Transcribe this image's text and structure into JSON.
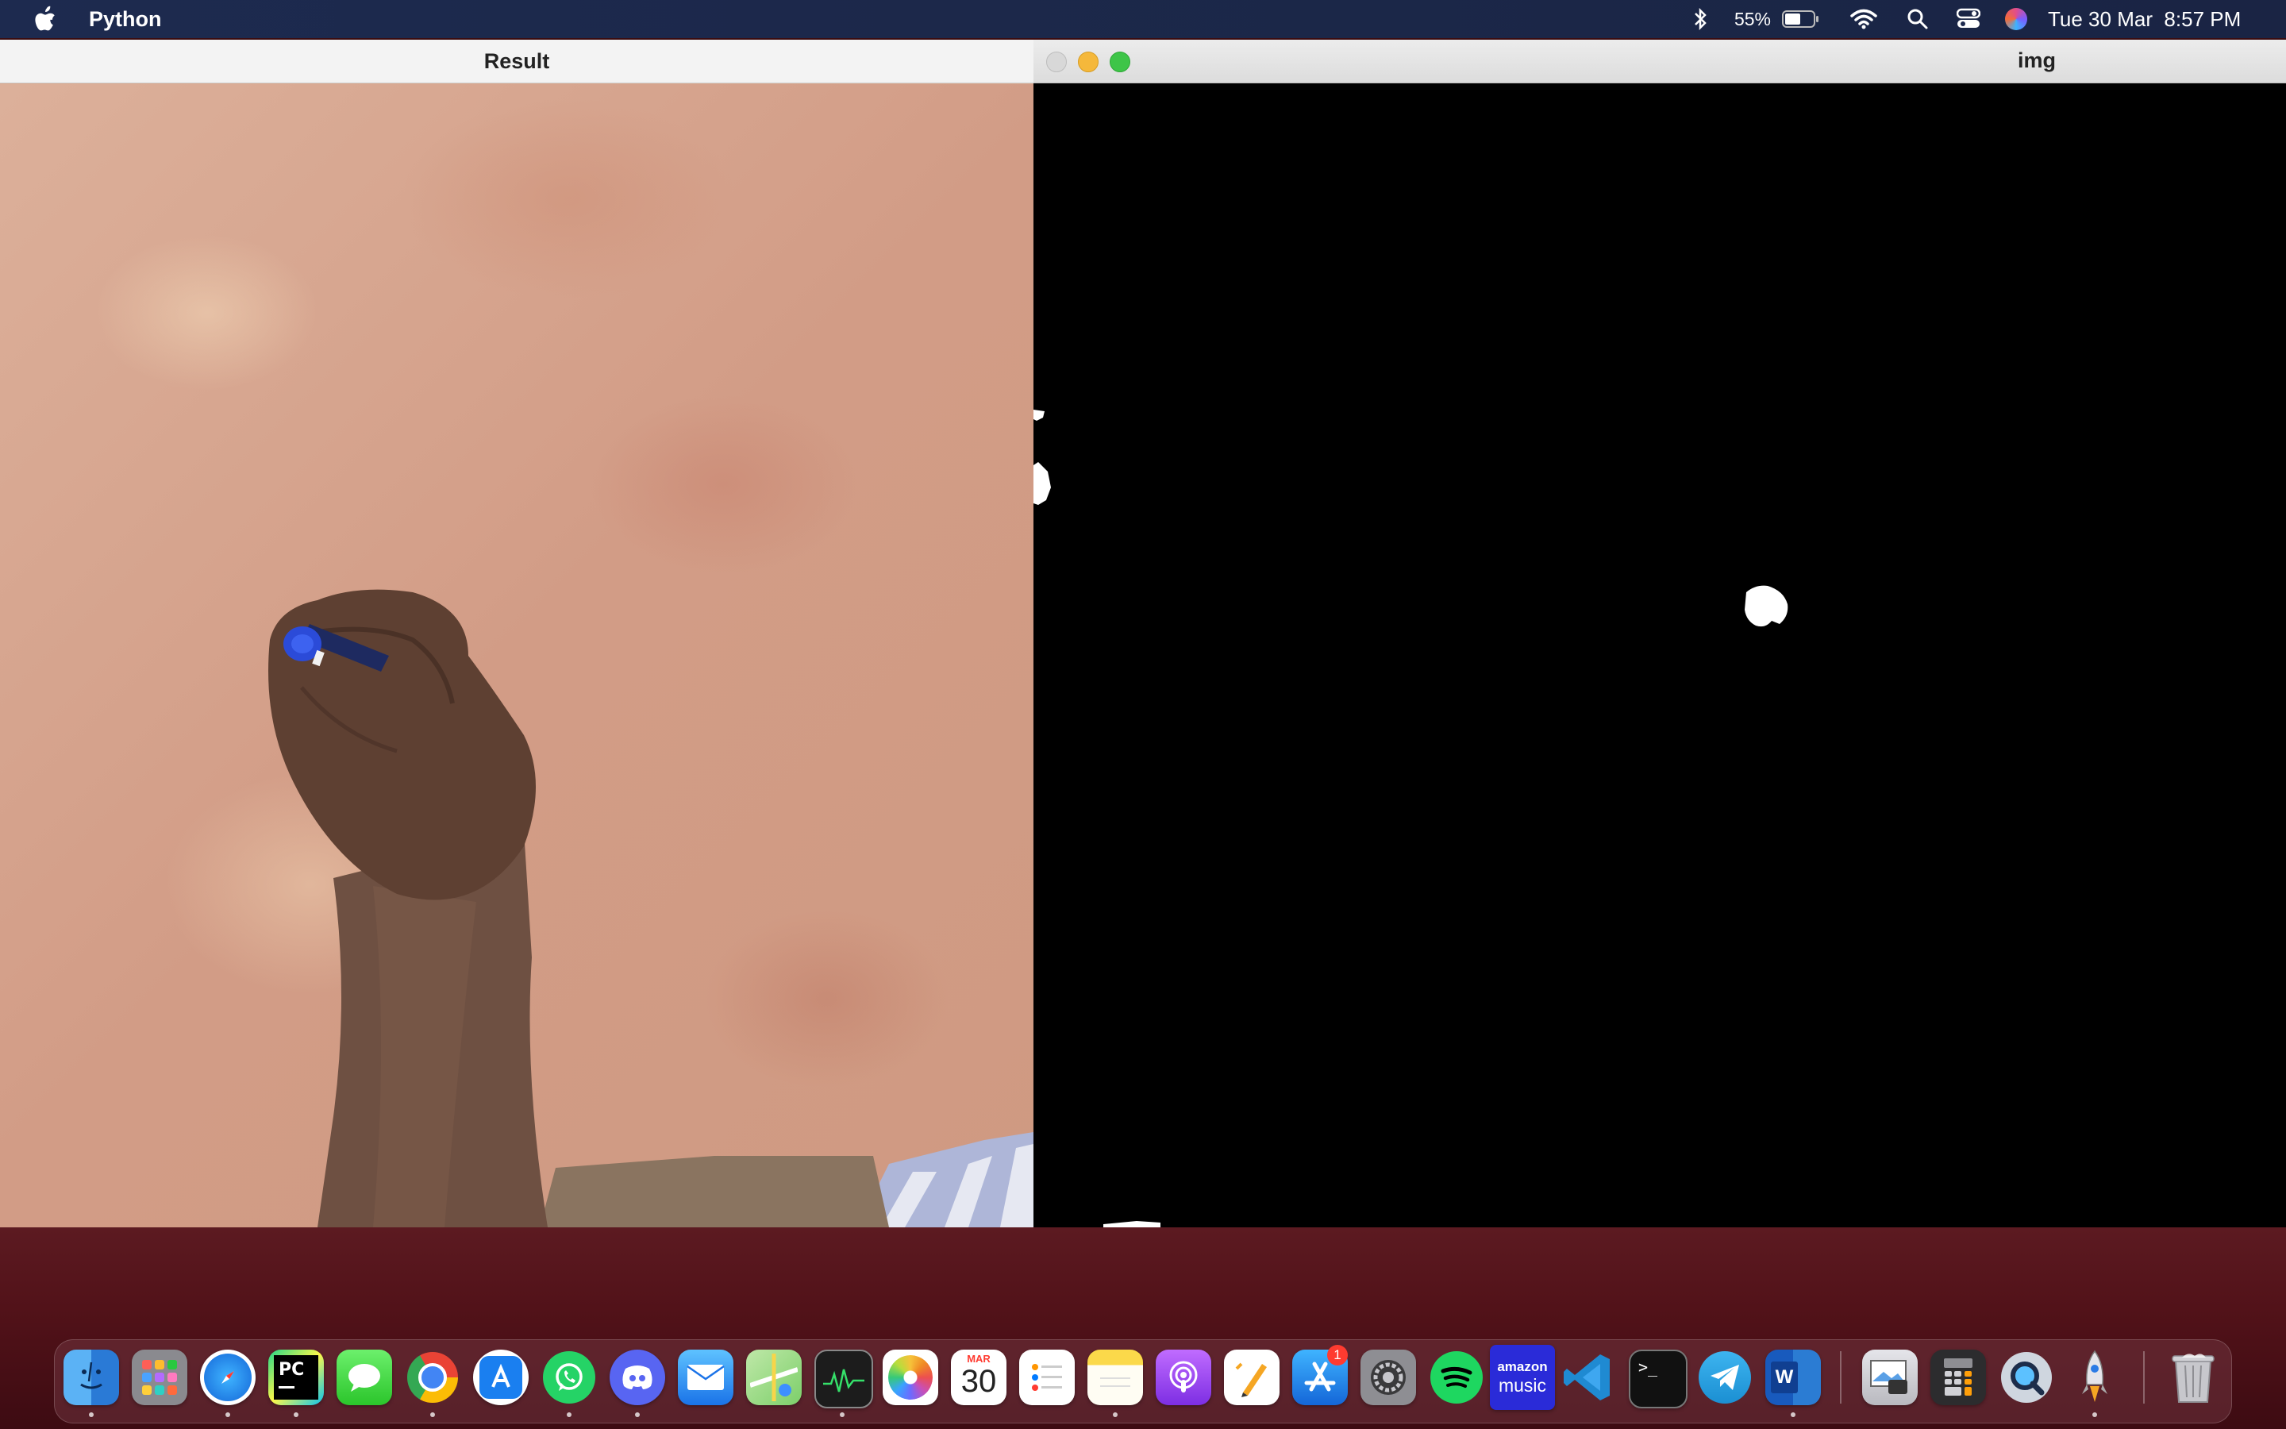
{
  "menubar": {
    "app_name": "Python",
    "battery_percent": "55%",
    "battery_level": 0.55,
    "datetime": "Tue 30 Mar  8:57 PM",
    "icons": [
      "apple-icon",
      "bluetooth-icon",
      "battery-icon",
      "wifi-icon",
      "spotlight-search-icon",
      "control-center-icon",
      "siri-icon"
    ]
  },
  "windows": {
    "result": {
      "title": "Result"
    },
    "img": {
      "title": "img"
    }
  },
  "dock": {
    "calendar": {
      "month": "MAR",
      "day": "30"
    },
    "pycharm_label": "PC",
    "amazon_music": {
      "line1": "amazon",
      "line2": "music"
    },
    "word_label": "W",
    "terminal_label": ">_",
    "appstore_badge": "1",
    "apps": [
      "Finder",
      "Launchpad",
      "Safari",
      "PyCharm",
      "Messages",
      "Chrome",
      "Xcode",
      "WhatsApp",
      "Discord",
      "Mail",
      "Maps",
      "Activity Monitor",
      "Photos",
      "Calendar",
      "Reminders",
      "Notes",
      "Podcasts",
      "Pages",
      "App Store",
      "System Preferences",
      "Spotify",
      "Amazon Music",
      "Visual Studio Code",
      "Terminal",
      "Telegram",
      "Microsoft Word",
      "Preview",
      "Calculator",
      "QuickTime Player",
      "Rocket Typist",
      "Trash"
    ]
  },
  "colors": {
    "menubar_bg": "#1d2a4f",
    "desktop_bg": "#521219",
    "traffic_close": "#d8d8d8",
    "traffic_min": "#f5b83b",
    "traffic_max": "#3ec548"
  }
}
